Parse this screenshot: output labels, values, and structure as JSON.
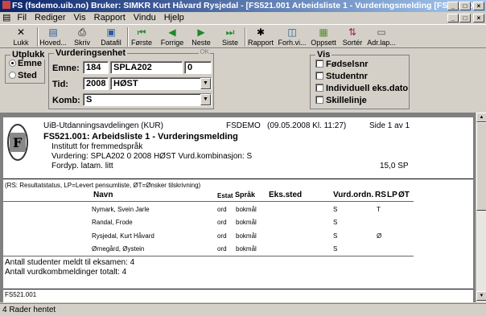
{
  "window": {
    "title": "FS (fsdemo.uib.no) Bruker: SIMKR Kurt Håvard Rysjedal - [FS521.001 Arbeidsliste 1 - Vurderingsmelding [FS521.001]]",
    "controls": [
      "_",
      "□",
      "×"
    ],
    "mdi_controls": [
      "_",
      "□",
      "×"
    ]
  },
  "menu": {
    "items": [
      "Fil",
      "Rediger",
      "Vis",
      "Rapport",
      "Vindu",
      "Hjelp"
    ]
  },
  "toolbar": {
    "buttons": [
      {
        "label": "Lukk",
        "icon": "close-icon",
        "glyph": "✕"
      },
      {
        "label": "Hoved...",
        "icon": "main-form-icon",
        "glyph": "▤"
      },
      {
        "label": "Skriv",
        "icon": "print-icon",
        "glyph": "⎙"
      },
      {
        "label": "Datafil",
        "icon": "save-datafile-icon",
        "glyph": "▣"
      },
      {
        "label": "Første",
        "icon": "first-record-icon",
        "glyph": "⏮"
      },
      {
        "label": "Forrige",
        "icon": "previous-record-icon",
        "glyph": "◀"
      },
      {
        "label": "Neste",
        "icon": "next-record-icon",
        "glyph": "▶"
      },
      {
        "label": "Siste",
        "icon": "last-record-icon",
        "glyph": "⏭"
      },
      {
        "label": "Rapport",
        "icon": "report-icon",
        "glyph": "✱"
      },
      {
        "label": "Forh.vi...",
        "icon": "preview-icon",
        "glyph": "◫"
      },
      {
        "label": "Oppsett",
        "icon": "setup-icon",
        "glyph": "▦"
      },
      {
        "label": "Sortér",
        "icon": "sort-icon",
        "glyph": "⇅"
      },
      {
        "label": "Adr.lap...",
        "icon": "address-label-icon",
        "glyph": "▭"
      }
    ]
  },
  "utplukk": {
    "legend": "Utplukk",
    "options": [
      {
        "label": "Emne",
        "selected": true
      },
      {
        "label": "Sted",
        "selected": false
      }
    ]
  },
  "vurderingsenhet": {
    "legend": "Vurderingsenhet",
    "ok_label": "OK",
    "emne_label": "Emne:",
    "emne_inst": "184",
    "emne_kode": "SPLA202",
    "emne_versjon": "0",
    "tid_label": "Tid:",
    "tid_year": "2008",
    "tid_term": "HØST",
    "komb_label": "Komb:",
    "komb_value": "S"
  },
  "vis": {
    "legend": "Vis",
    "options": [
      {
        "label": "Fødselsnr",
        "checked": false
      },
      {
        "label": "Studentnr",
        "checked": false
      },
      {
        "label": "Individuell eks.dato",
        "checked": false
      },
      {
        "label": "Skillelinje",
        "checked": false
      }
    ]
  },
  "report": {
    "logo_text": "F",
    "org": "UiB-Utdanningsavdelingen (KUR)",
    "db": "FSDEMO",
    "timestamp": "(09.05.2008 Kl. 11:27)",
    "page": "Side 1 av 1",
    "title": "FS521.001: Arbeidsliste 1 - Vurderingsmelding",
    "institute": "Institutt for fremmedspråk",
    "vurdering": "Vurdering:  SPLA202 0 2008 HØST Vurd.kombinasjon: S",
    "fordyp": "Fordyp. latam. litt",
    "sp": "15,0 SP",
    "legend_note": "(RS: Resultatstatus, LP=Levert pensumliste, ØT=Ønsker tilskrivning)",
    "columns": {
      "navn": "Navn",
      "estat": "Estat",
      "sprak": "Språk",
      "eks_sted": "Eks.sted",
      "vurd_ordn": "Vurd.ordn.",
      "rs": "RS",
      "lp": "LP",
      "ot": "ØT"
    },
    "rows": [
      {
        "navn": "Nymark, Svein Jarle",
        "estat": "ord",
        "sprak": "bokmål",
        "eks_sted": "",
        "vurd_ordn": "S",
        "rs": "",
        "lp": "T",
        "ot": ""
      },
      {
        "navn": "Randal, Frode",
        "estat": "ord",
        "sprak": "bokmål",
        "eks_sted": "",
        "vurd_ordn": "S",
        "rs": "",
        "lp": "",
        "ot": ""
      },
      {
        "navn": "Rysjedal, Kurt Håvard",
        "estat": "ord",
        "sprak": "bokmål",
        "eks_sted": "",
        "vurd_ordn": "S",
        "rs": "",
        "lp": "Ø",
        "ot": ""
      },
      {
        "navn": "Ørnegård, Øystein",
        "estat": "ord",
        "sprak": "bokmål",
        "eks_sted": "",
        "vurd_ordn": "S",
        "rs": "",
        "lp": "",
        "ot": ""
      }
    ],
    "summary_students": "Antall studenter meldt til eksamen: 4",
    "summary_vurd": "Antall vurdkombmeldinger totalt: 4",
    "footer_code": "FS521.001"
  },
  "status": {
    "text": "4 Rader hentet"
  }
}
